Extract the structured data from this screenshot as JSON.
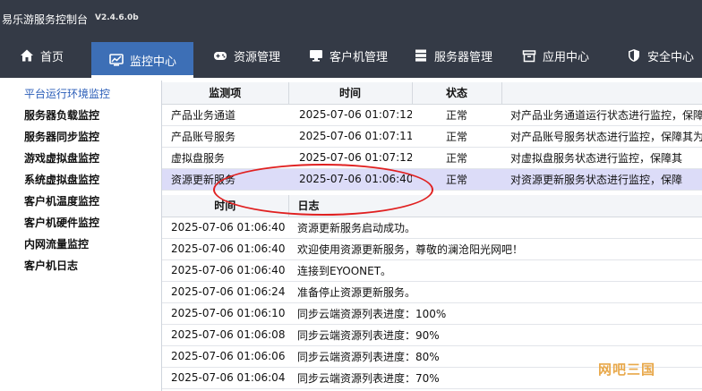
{
  "titlebar": {
    "title": "易乐游服务控制台",
    "version": "V2.4.6.0b"
  },
  "nav": [
    {
      "label": "首页",
      "icon": "home-icon"
    },
    {
      "label": "监控中心",
      "icon": "monitor-icon",
      "active": true
    },
    {
      "label": "资源管理",
      "icon": "gamepad-icon"
    },
    {
      "label": "客户机管理",
      "icon": "computer-icon"
    },
    {
      "label": "服务器管理",
      "icon": "server-icon"
    },
    {
      "label": "应用中心",
      "icon": "box-icon"
    },
    {
      "label": "安全中心",
      "icon": "shield-icon"
    }
  ],
  "sidebar": [
    {
      "label": "平台运行环境监控",
      "active": true
    },
    {
      "label": "服务器负载监控"
    },
    {
      "label": "服务器同步监控"
    },
    {
      "label": "游戏虚拟盘监控"
    },
    {
      "label": "系统虚拟盘监控"
    },
    {
      "label": "客户机温度监控"
    },
    {
      "label": "客户机硬件监控"
    },
    {
      "label": "内网流量监控"
    },
    {
      "label": "客户机日志"
    }
  ],
  "monitor_table": {
    "headers": [
      "监测项",
      "时间",
      "状态",
      ""
    ],
    "rows": [
      {
        "item": "产品业务通道",
        "time": "2025-07-06 01:07:12",
        "status": "正常",
        "desc": "对产品业务通道运行状态进行监控，保障"
      },
      {
        "item": "产品账号服务",
        "time": "2025-07-06 01:07:11",
        "status": "正常",
        "desc": "对产品账号服务状态进行监控，保障其为"
      },
      {
        "item": "虚拟盘服务",
        "time": "2025-07-06 01:07:12",
        "status": "正常",
        "desc": "对虚拟盘服务状态进行监控，保障其"
      },
      {
        "item": "资源更新服务",
        "time": "2025-07-06 01:06:40",
        "status": "正常",
        "desc": "对资源更新服务状态进行监控，保障"
      }
    ]
  },
  "log_table": {
    "headers": [
      "时间",
      "日志"
    ],
    "rows": [
      {
        "time": "2025-07-06 01:06:40",
        "log": "资源更新服务启动成功。"
      },
      {
        "time": "2025-07-06 01:06:40",
        "log": "欢迎使用资源更新服务，尊敬的澜沧阳光网吧！"
      },
      {
        "time": "2025-07-06 01:06:40",
        "log": "连接到EYOONET。"
      },
      {
        "time": "2025-07-06 01:06:24",
        "log": "准备停止资源更新服务。"
      },
      {
        "time": "2025-07-06 01:06:10",
        "log": "同步云端资源列表进度：100%"
      },
      {
        "time": "2025-07-06 01:06:08",
        "log": "同步云端资源列表进度：90%"
      },
      {
        "time": "2025-07-06 01:06:06",
        "log": "同步云端资源列表进度：80%"
      },
      {
        "time": "2025-07-06 01:06:04",
        "log": "同步云端资源列表进度：70%"
      }
    ]
  },
  "watermark": "网吧三国"
}
